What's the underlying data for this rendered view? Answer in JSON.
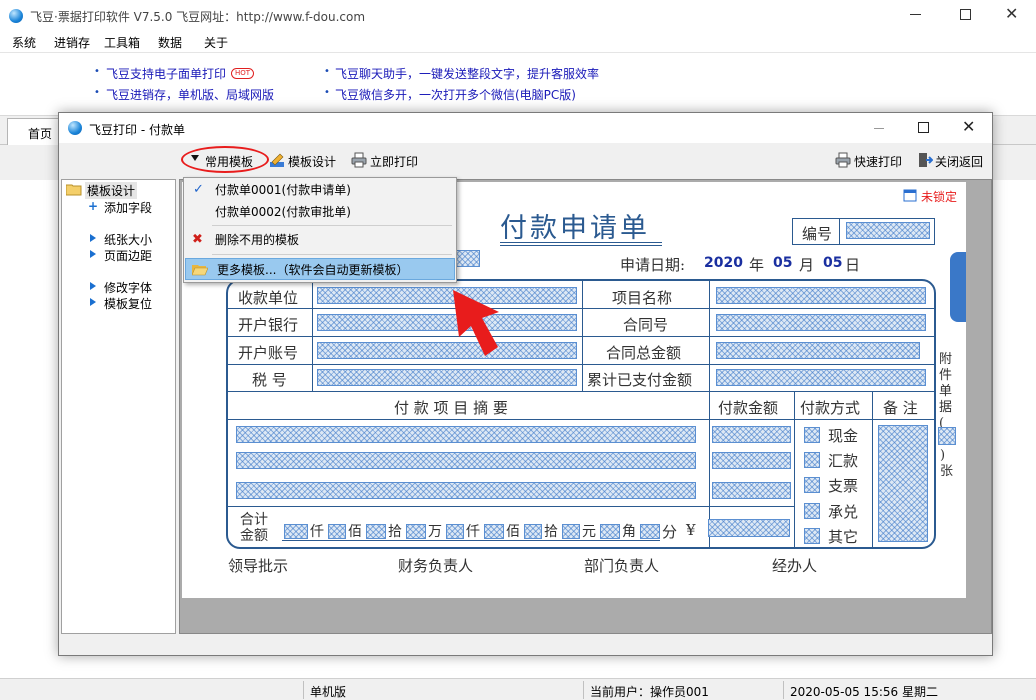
{
  "main_window": {
    "title": "飞豆·票据打印软件 V7.5.0   飞豆网址：http://www.f-dou.com"
  },
  "menubar": [
    "系统",
    "进销存",
    "工具箱",
    "数据",
    "关于"
  ],
  "ads": {
    "left1": "飞豆支持电子面单打印",
    "hot": "HOT",
    "left2": "飞豆进销存，单机版、局域网版",
    "right1": "飞豆聊天助手，一键发送整段文字，提升客服效率",
    "right2": "飞豆微信多开，一次打开多个微信(电脑PC版)"
  },
  "tab_home": "首页",
  "dialog": {
    "title": "飞豆打印 - 付款单",
    "toolbar": {
      "templates": "常用模板",
      "design": "模板设计",
      "print_now": "立即打印",
      "quick_print": "快速打印",
      "close_return": "关闭返回"
    },
    "sidebar": {
      "root": "模板设计",
      "add_field": "添加字段",
      "paper_size": "纸张大小",
      "page_margin": "页面边距",
      "change_font": "修改字体",
      "reset_template": "模板复位"
    },
    "dropdown": {
      "item1": "付款单0001(付款申请单)",
      "item2": "付款单0002(付款审批单)",
      "delete": "删除不用的模板",
      "more": "更多模板...（软件会自动更新模板）"
    },
    "lock_status": "未锁定"
  },
  "voucher": {
    "title": "付款申请单",
    "number_label": "编号",
    "date_label": "申请日期:",
    "year": "2020",
    "year_unit": "年",
    "month": "05",
    "month_unit": "月",
    "day": "05",
    "day_unit": "日",
    "payee": "收款单位",
    "project_name": "项目名称",
    "bank": "开户银行",
    "contract_no": "合同号",
    "account": "开户账号",
    "contract_total": "合同总金额",
    "tax_no": "税   号",
    "paid_total": "累计已支付金额",
    "summary": "付 款 项 目 摘 要",
    "pay_amount": "付款金额",
    "pay_method": "付款方式",
    "remark": "备 注",
    "methods": [
      "现金",
      "汇款",
      "支票",
      "承兑",
      "其它"
    ],
    "total_label1": "合计",
    "total_label2": "金额",
    "units": [
      "仟",
      "佰",
      "拾",
      "万",
      "仟",
      "佰",
      "拾",
      "元",
      "角",
      "分"
    ],
    "yen": "¥",
    "leader": "领导批示",
    "finance": "财务负责人",
    "dept": "部门负责人",
    "handler": "经办人",
    "side_note_top": "附件单据(",
    "side_note_bottom": ")张"
  },
  "statusbar": {
    "mode": "单机版",
    "user": "当前用户：操作员001",
    "datetime": "2020-05-05  15:56  星期二"
  },
  "colors": {
    "accent_red": "#e81c1c",
    "voucher_blue": "#2b5a90",
    "menu_highlight": "#99c9ef"
  }
}
